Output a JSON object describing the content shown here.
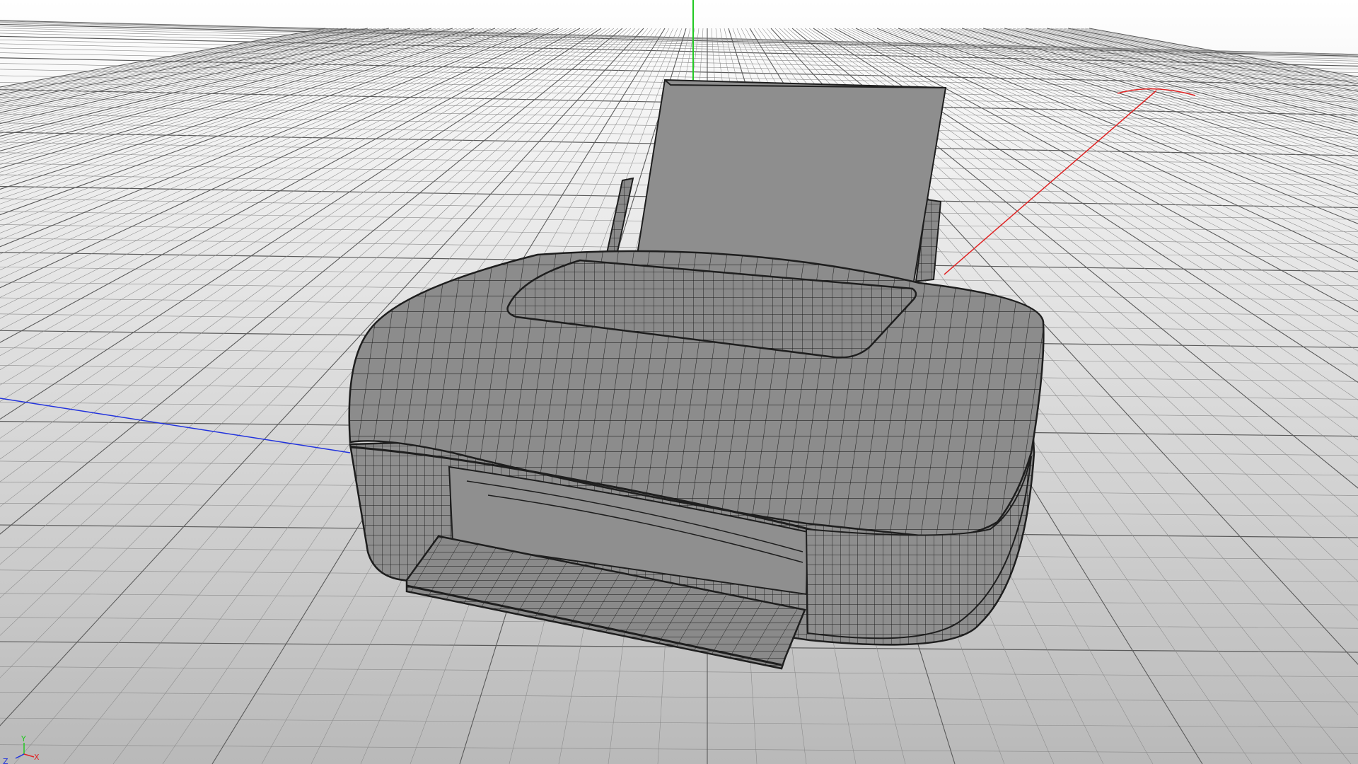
{
  "viewport": {
    "background_top": "#f6f6f6",
    "background_bottom": "#bdbdbd",
    "grid_color": "#8a8a8a",
    "grid_major_color": "#5a5a5a"
  },
  "world_axes": {
    "x_color": "#e02424",
    "y_color": "#22c922",
    "z_color": "#2233dd"
  },
  "axis_gizmo": {
    "y_label": "Y",
    "x_label": "X",
    "z_label": "Z",
    "x_color": "#e02424",
    "y_color": "#22c922",
    "z_color": "#2233dd"
  },
  "model": {
    "name": "inkjet-printer",
    "shading": "wireframe-on-shaded",
    "surface_color": "#8c8c8c",
    "wire_color": "#1e1e1e"
  }
}
